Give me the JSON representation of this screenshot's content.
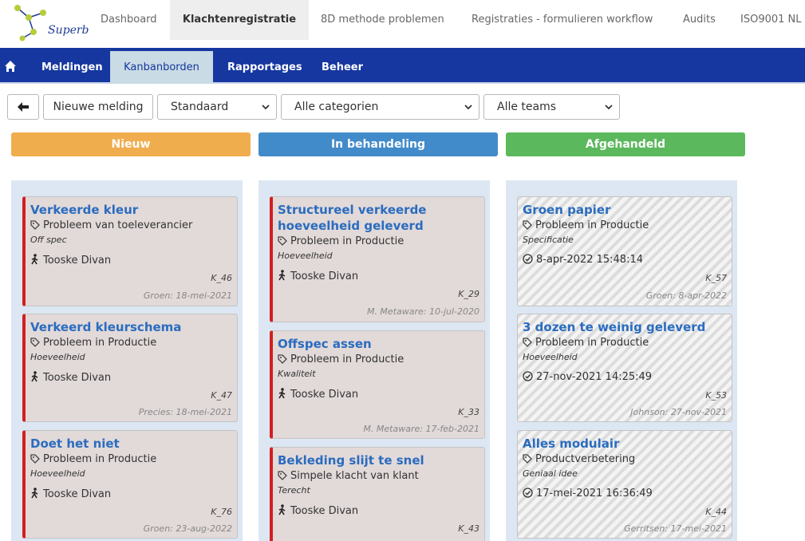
{
  "app": {
    "logo_text": "Superb"
  },
  "top_nav": [
    {
      "label": "Dashboard"
    },
    {
      "label": "Klachtenregistratie"
    },
    {
      "label": "8D methode problemen"
    },
    {
      "label": "Registraties - formulieren workflow"
    },
    {
      "label": "Audits"
    },
    {
      "label": "ISO9001 NL"
    }
  ],
  "sub_nav": [
    {
      "label": "Meldingen"
    },
    {
      "label": "Kanbanborden"
    },
    {
      "label": "Rapportages"
    },
    {
      "label": "Beheer"
    }
  ],
  "toolbar": {
    "new_label": "Nieuwe melding",
    "view_select": "Standaard",
    "category_select": "Alle categorien",
    "team_select": "Alle teams"
  },
  "columns": [
    {
      "title": "Nieuw",
      "color": "#f0ad4e",
      "cards": [
        {
          "title": "Verkeerde kleur",
          "category": "Probleem van toeleverancier",
          "subcategory": "Off spec",
          "person": "Tooske Divan",
          "id": "K_46",
          "footer": "Groen: 18-mei-2021"
        },
        {
          "title": "Verkeerd kleurschema",
          "category": "Probleem in Productie",
          "subcategory": "Hoeveelheid",
          "person": "Tooske Divan",
          "id": "K_47",
          "footer": "Precies: 18-mei-2021"
        },
        {
          "title": "Doet het niet",
          "category": "Probleem in Productie",
          "subcategory": "Hoeveelheid",
          "person": "Tooske Divan",
          "id": "K_76",
          "footer": "Groen: 23-aug-2022"
        }
      ]
    },
    {
      "title": "In behandeling",
      "color": "#428bca",
      "cards": [
        {
          "title": "Structureel verkeerde hoeveelheid geleverd",
          "category": "Probleem in Productie",
          "subcategory": "Hoeveelheid",
          "person": "Tooske Divan",
          "id": "K_29",
          "footer": "M. Metaware: 10-jul-2020"
        },
        {
          "title": "Offspec assen",
          "category": "Probleem in Productie",
          "subcategory": "Kwaliteit",
          "person": "Tooske Divan",
          "id": "K_33",
          "footer": "M. Metaware: 17-feb-2021"
        },
        {
          "title": "Bekleding slijt te snel",
          "category": "Simpele klacht van klant",
          "subcategory": "Terecht",
          "person": "Tooske Divan",
          "id": "K_43",
          "footer": ""
        }
      ]
    },
    {
      "title": "Afgehandeld",
      "color": "#5cb85c",
      "cards": [
        {
          "title": "Groen papier",
          "category": "Probleem in Productie",
          "subcategory": "Specificatie",
          "date": "8-apr-2022 15:48:14",
          "id": "K_57",
          "footer": "Groen: 8-apr-2022"
        },
        {
          "title": "3 dozen te weinig geleverd",
          "category": "Probleem in Productie",
          "subcategory": "Hoeveelheid",
          "date": "27-nov-2021 14:25:49",
          "id": "K_53",
          "footer": "Johnson: 27-nov-2021"
        },
        {
          "title": "Alles modulair",
          "category": "Productverbetering",
          "subcategory": "Geniaal idee",
          "date": "17-mei-2021 16:36:49",
          "id": "K_44",
          "footer": "Gerritsen: 17-mei-2021"
        }
      ]
    }
  ]
}
